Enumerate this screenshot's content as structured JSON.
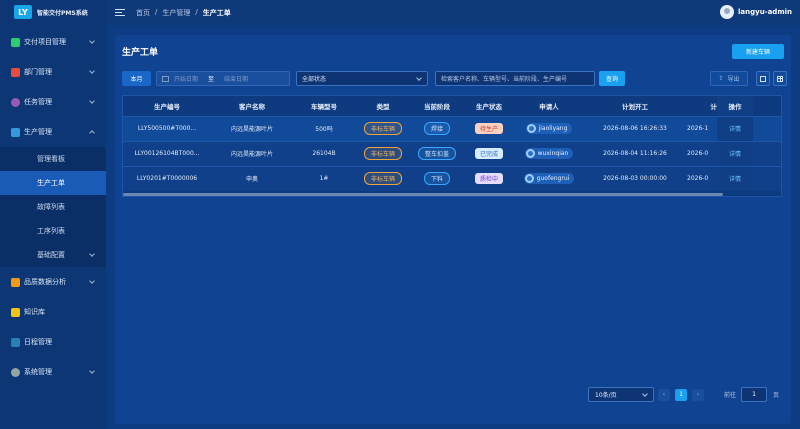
{
  "brand": {
    "logo": "LY",
    "name": "智能交付PMS系统"
  },
  "sidebar": {
    "items": [
      {
        "label": "交付项目管理",
        "color": "#2ecc71"
      },
      {
        "label": "部门管理",
        "color": "#e74c3c"
      },
      {
        "label": "任务管理",
        "color": "#9b59b6"
      },
      {
        "label": "生产管理",
        "color": "#3498db"
      },
      {
        "label": "品质数据分析",
        "color": "#f39c12"
      },
      {
        "label": "知识库",
        "color": "#f1c40f"
      },
      {
        "label": "日程管理",
        "color": "#2980b9"
      },
      {
        "label": "系统管理",
        "color": "#95a5a6"
      }
    ],
    "subitems": [
      "管理看板",
      "生产工单",
      "故障列表",
      "工序列表",
      "基础配置"
    ]
  },
  "topbar": {
    "breadcrumb": [
      "首页",
      "生产管理",
      "生产工单"
    ],
    "separator": "/",
    "username": "langyu-admin"
  },
  "page": {
    "title": "生产工单",
    "new_button": "新建车辆"
  },
  "toolbar": {
    "month_button": "本月",
    "start_placeholder": "开始日期",
    "range_sep": "至",
    "end_placeholder": "结束日期",
    "status_select": "全部状态",
    "search_placeholder": "检索客户名称、车辆型号、当前阶段、生产编号",
    "query_button": "查询",
    "export_button": "导出"
  },
  "table": {
    "headers": [
      "生产编号",
      "客户名称",
      "车辆型号",
      "类型",
      "当前阶段",
      "生产状态",
      "申请人",
      "计划开工",
      "计",
      "操作"
    ],
    "rows": [
      {
        "code": "LLY500500#T000...",
        "customer": "内远昊能源叶片",
        "model": "500吗",
        "type": "非标车辆",
        "stage": "焊接",
        "status": "待生产",
        "status_bg": "#ffd1c2",
        "status_fg": "#c0392b",
        "applicant": "jiaoliyang",
        "plan_start": "2026-08-06 16:26:33",
        "plan_end": "2026-1",
        "action": "详情"
      },
      {
        "code": "LLY00126104BT000...",
        "customer": "内远昊能源叶片",
        "model": "26104B",
        "type": "非标车辆",
        "stage": "整车扣盖",
        "status": "已完成",
        "status_bg": "#d7ecff",
        "status_fg": "#2d6fb8",
        "applicant": "wuxinqian",
        "plan_start": "2026-08-04 11:16:26",
        "plan_end": "2026-0",
        "action": "详情"
      },
      {
        "code": "LLY0201#T0000006",
        "customer": "申奥",
        "model": "1#",
        "type": "非标车辆",
        "stage": "下料",
        "status": "质检中",
        "status_bg": "#e6dcff",
        "status_fg": "#6c45c9",
        "applicant": "guofengrui",
        "plan_start": "2026-08-03 00:00:00",
        "plan_end": "2026-0",
        "action": "详情"
      }
    ]
  },
  "pagination": {
    "page_size": "10条/页",
    "prev": "‹",
    "current": "1",
    "next": "›",
    "goto_label": "前往",
    "goto_value": "1",
    "page_unit": "页"
  }
}
